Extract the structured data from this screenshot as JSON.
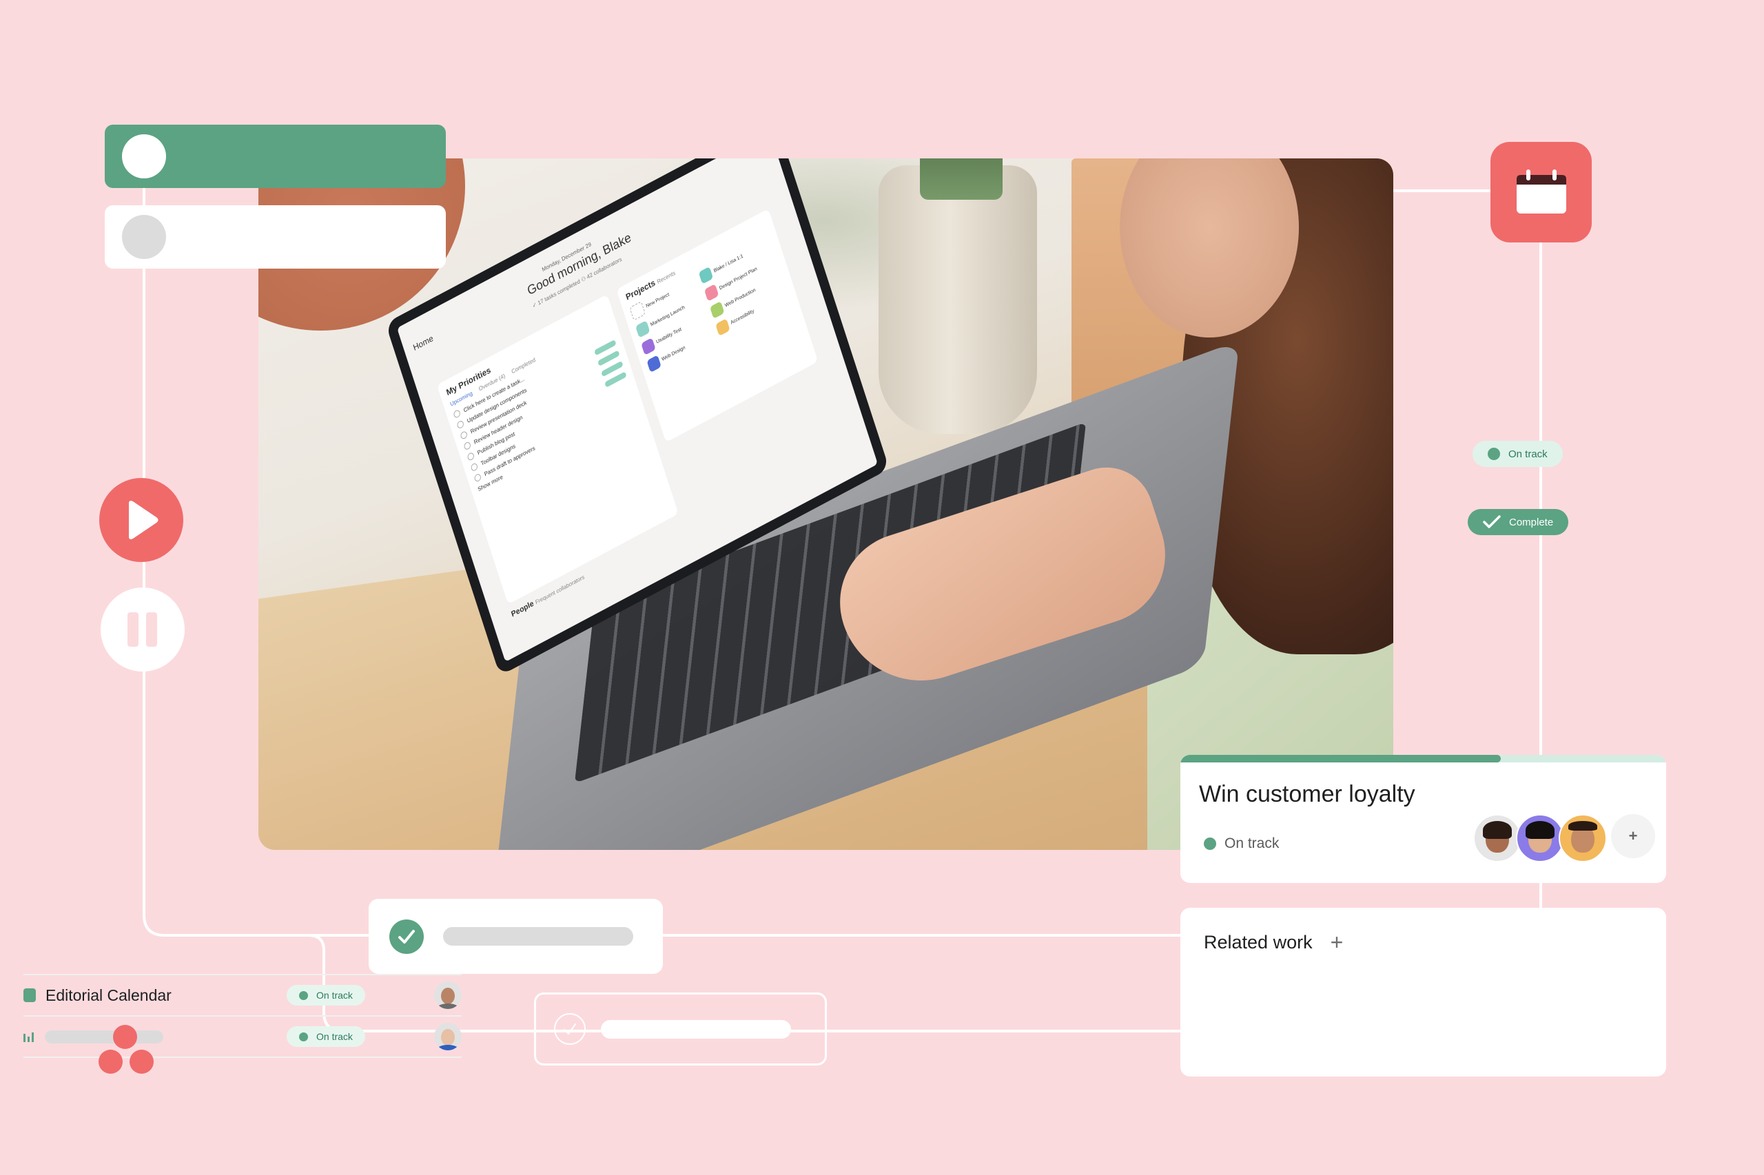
{
  "colors": {
    "background": "#fbdadd",
    "brand_coral": "#f06a6a",
    "status_green": "#5ba383",
    "status_green_light": "#dff3eb",
    "placeholder_gray": "#dcdbdc"
  },
  "photo": {
    "laptop_screen": {
      "page": "Home",
      "date": "Monday, December 29",
      "greeting": "Good morning, Blake",
      "stats": "✓ 17 tasks completed   ⚇ 42 collaborators",
      "priorities": {
        "title": "My Priorities",
        "tabs": [
          "Upcoming",
          "Overdue (4)",
          "Completed"
        ],
        "tasks": [
          "Click here to create a task...",
          "Update design components",
          "Review presentation deck",
          "Review header design",
          "Publish blog post",
          "Toolbar designs",
          "Pass draft to approvers"
        ],
        "show_more": "Show more"
      },
      "projects": {
        "title": "Projects",
        "filter": "Recents",
        "items": [
          {
            "name": "New Project",
            "color": "#ffffff"
          },
          {
            "name": "Blake / Lisa 1:1",
            "color": "#6ec9c0"
          },
          {
            "name": "Marketing Launch",
            "color": "#8fd3c8"
          },
          {
            "name": "Design Project Plan",
            "color": "#f08aa0"
          },
          {
            "name": "Usability Test",
            "color": "#9b6ddb"
          },
          {
            "name": "Web Production",
            "color": "#a8cf6a"
          },
          {
            "name": "Web Design",
            "color": "#4f6bd6"
          },
          {
            "name": "Accessibility",
            "color": "#f2c061"
          }
        ]
      },
      "people": {
        "title": "People",
        "filter": "Frequent collaborators"
      }
    }
  },
  "status_pills": {
    "on_track": "On track",
    "complete": "Complete"
  },
  "goal_card": {
    "title": "Win customer loyalty",
    "status": "On track",
    "progress_percent": 66,
    "add_member": "+",
    "avatars": [
      {
        "name": "member-1",
        "bg": "#e6e6e6",
        "skin": "#a86d4f",
        "hair": "#2a1a14"
      },
      {
        "name": "member-2",
        "bg": "#8a7be8",
        "skin": "#e0b08f",
        "hair": "#141010"
      },
      {
        "name": "member-3",
        "bg": "#f3b85a",
        "skin": "#c58b66",
        "hair": "#2a1a14"
      }
    ]
  },
  "related_work": {
    "title": "Related work",
    "add": "+",
    "rows": [
      {
        "name": "Editorial Calendar",
        "icon": "project-square-icon",
        "status": "On track",
        "avatar": {
          "skin": "#b98466",
          "hair": "#3a2a20",
          "shirt": "#6b6b6b"
        }
      },
      {
        "name": "",
        "icon": "portfolio-bars-icon",
        "status": "On track",
        "avatar": {
          "skin": "#e7c0a6",
          "hair": "#6a4a30",
          "shirt": "#2f5fbf"
        }
      }
    ]
  }
}
